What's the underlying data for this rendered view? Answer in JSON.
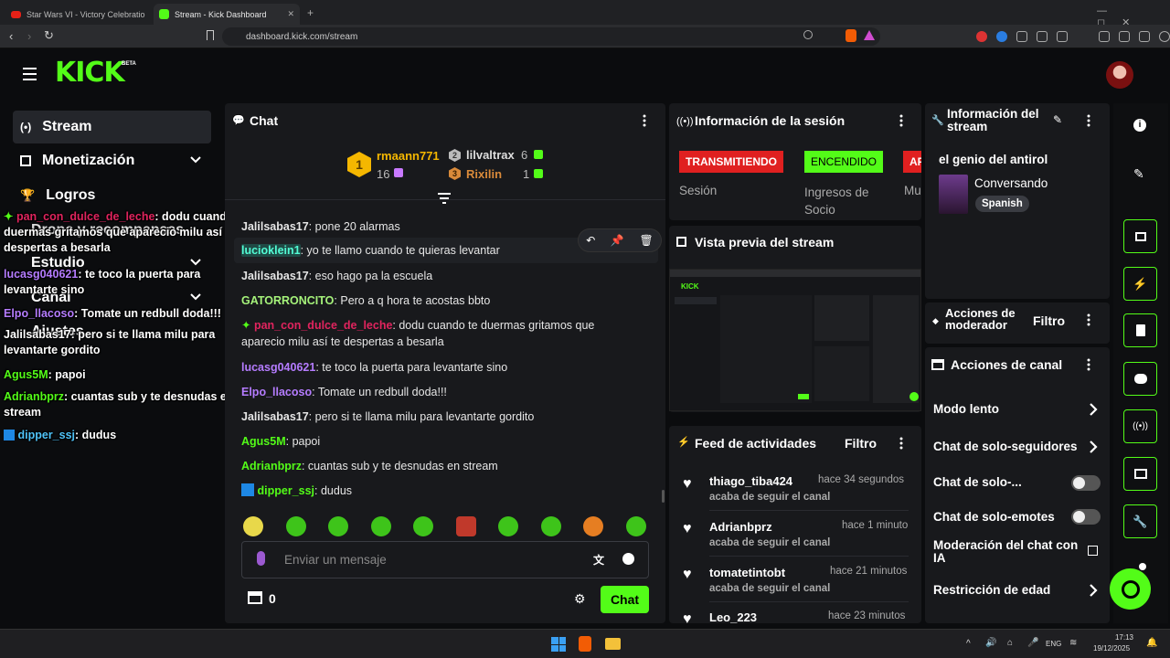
{
  "browser": {
    "tabs": [
      {
        "title": "Star Wars VI - Victory Celebration Ext"
      },
      {
        "title": "Stream - Kick Dashboard"
      }
    ],
    "url": "dashboard.kick.com/stream"
  },
  "header": {
    "logo": "KICK",
    "beta": "BETA"
  },
  "sidebar": {
    "items": [
      {
        "label": "Stream",
        "icon": "broadcast-icon"
      },
      {
        "label": "Monetización",
        "icon": "chart-icon"
      },
      {
        "label": "Logros",
        "icon": "trophy-icon"
      },
      {
        "label": "Drops y recompensas",
        "icon": "gift-icon"
      },
      {
        "label": "Estudio",
        "icon": "video-icon"
      },
      {
        "label": "Canal",
        "icon": "tv-icon"
      },
      {
        "label": "Ajustes",
        "icon": "gear-icon"
      }
    ]
  },
  "overlay": [
    {
      "user": "pan_con_dulce_de_leche",
      "text": ": dodu cuando te duermas gritamos que aparecio milu así te despertas a besarla",
      "color": "#e0245e"
    },
    {
      "user": "lucasg040621",
      "text": ": te toco la puerta para levantarte sino",
      "color": "#b57cff"
    },
    {
      "user": "Elpo_llacoso",
      "text": ": Tomate un redbull doda!!!",
      "color": "#b57cff"
    },
    {
      "user": "Jalilsabas17",
      "text": ": pero si te llama milu para levantarte gordito",
      "color": "#ffffff"
    },
    {
      "user": "Agus5M",
      "text": ": papoi",
      "color": "#53fc18"
    },
    {
      "user": "Adrianbprz",
      "text": ": cuantas sub y te desnudas en stream",
      "color": "#53fc18"
    },
    {
      "user": "dipper_ssj",
      "text": ": dudus",
      "color": "#4fc3f7"
    }
  ],
  "chat": {
    "title": "Chat",
    "leaderboard": [
      {
        "rank": "1",
        "name": "rmaann771",
        "count": "16"
      },
      {
        "rank": "2",
        "name": "lilvaltrax",
        "count": "6"
      },
      {
        "rank": "3",
        "name": "Rixilin",
        "count": "1"
      }
    ],
    "messages": [
      {
        "user": "Jalilsabas17",
        "text": ": pone 20 alarmas",
        "color": "#e6e6e6"
      },
      {
        "user": "lucioklein1",
        "text": ": yo te llamo cuando te quieras levantar",
        "color": "#53fcd5"
      },
      {
        "user": "Jalilsabas17",
        "text": ": eso hago pa la escuela",
        "color": "#e6e6e6"
      },
      {
        "user": "GATORRONCITO",
        "text": ": Pero a q hora te acostas bbto",
        "color": "#a5f27a"
      },
      {
        "user": "pan_con_dulce_de_leche",
        "text": ": dodu cuando te duermas gritamos que aparecio milu así te despertas a besarla",
        "color": "#e0245e"
      },
      {
        "user": "lucasg040621",
        "text": ": te toco la puerta para levantarte sino",
        "color": "#b57cff"
      },
      {
        "user": "Elpo_llacoso",
        "text": ": Tomate un redbull doda!!!",
        "color": "#b57cff"
      },
      {
        "user": "Jalilsabas17",
        "text": ": pero si te llama milu para levantarte gordito",
        "color": "#e6e6e6"
      },
      {
        "user": "Agus5M",
        "text": ": papoi",
        "color": "#53fc18"
      },
      {
        "user": "Adrianbprz",
        "text": ": cuantas sub y te desnudas en stream",
        "color": "#53fc18"
      },
      {
        "user": "dipper_ssj",
        "text": ": dudus",
        "color": "#53fc18"
      }
    ],
    "input_placeholder": "Enviar un mensaje",
    "points": "0",
    "send_label": "Chat"
  },
  "session": {
    "title": "Información de la sesión",
    "badges": [
      "TRANSMITIENDO",
      "ENCENDIDO",
      "AF"
    ],
    "labels": [
      "Sesión",
      "Ingresos de Socio",
      "Mu"
    ]
  },
  "preview": {
    "title": "Vista previa del stream"
  },
  "feed": {
    "title": "Feed de actividades",
    "filter": "Filtro",
    "items": [
      {
        "name": "thiago_tiba424",
        "time": "hace 34 segundos",
        "sub": "acaba de seguir el canal"
      },
      {
        "name": "Adrianbprz",
        "time": "hace 1 minuto",
        "sub": "acaba de seguir el canal"
      },
      {
        "name": "tomatetintobt",
        "time": "hace 21 minutos",
        "sub": "acaba de seguir el canal"
      },
      {
        "name": "Leo_223",
        "time": "hace 23 minutos",
        "sub": ""
      }
    ]
  },
  "info": {
    "title": "Información del stream",
    "stream_title": "el genio del antirol",
    "category": "Conversando",
    "language": "Spanish"
  },
  "mod": {
    "title": "Acciones de moderador",
    "filter": "Filtro"
  },
  "channel": {
    "title": "Acciones de canal",
    "items": [
      {
        "label": "Modo lento",
        "control": "chevron"
      },
      {
        "label": "Chat de solo-seguidores",
        "control": "chevron"
      },
      {
        "label": "Chat de solo-...",
        "control": "toggle"
      },
      {
        "label": "Chat de solo-emotes",
        "control": "toggle"
      },
      {
        "label": "Moderación del chat con IA",
        "control": "external"
      },
      {
        "label": "Restricción de edad",
        "control": "chevron"
      }
    ]
  },
  "taskbar": {
    "lang": "ENG",
    "time": "17:13",
    "date": "19/12/2025"
  },
  "colors": {
    "accent": "#53fc18",
    "live": "#e02020",
    "panel": "#18191c"
  }
}
